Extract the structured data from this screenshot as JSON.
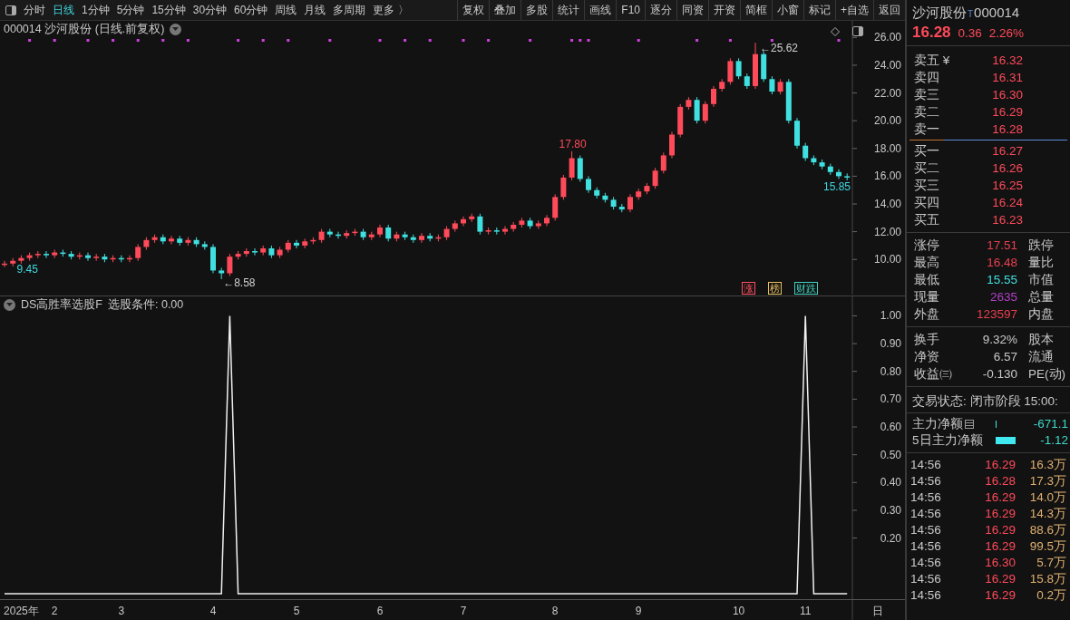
{
  "toolbar": {
    "periods": [
      {
        "label": "分时",
        "selected": false
      },
      {
        "label": "日线",
        "selected": true
      },
      {
        "label": "1分钟",
        "selected": false
      },
      {
        "label": "5分钟",
        "selected": false
      },
      {
        "label": "15分钟",
        "selected": false
      },
      {
        "label": "30分钟",
        "selected": false
      },
      {
        "label": "60分钟",
        "selected": false
      },
      {
        "label": "周线",
        "selected": false
      },
      {
        "label": "月线",
        "selected": false
      },
      {
        "label": "多周期",
        "selected": false
      },
      {
        "label": "更多 〉",
        "selected": false
      }
    ],
    "tools": [
      "复权",
      "叠加",
      "多股",
      "统计",
      "画线",
      "F10",
      "逐分",
      "同资",
      "开资",
      "简框",
      "小窗",
      "标记",
      "+自选",
      "返回"
    ]
  },
  "top_chart": {
    "title": "000014 沙河股份 (日线.前复权)",
    "chart_data": {
      "type": "candlestick",
      "ylim": [
        7.4,
        27.2
      ],
      "yticks": [
        {
          "value": 26,
          "label": "26.00"
        },
        {
          "value": 24,
          "label": "24.00"
        },
        {
          "value": 22,
          "label": "22.00"
        },
        {
          "value": 20,
          "label": "20.00"
        },
        {
          "value": 18,
          "label": "18.00"
        },
        {
          "value": 16,
          "label": "16.00"
        },
        {
          "value": 14,
          "label": "14.00"
        },
        {
          "value": 12,
          "label": "12.00"
        },
        {
          "value": 10,
          "label": "10.00"
        }
      ],
      "categories": [
        null,
        null,
        null,
        null,
        null,
        null,
        null,
        null,
        null,
        null,
        null,
        null,
        null,
        null,
        null,
        null,
        null,
        null,
        null,
        null,
        null,
        null,
        null,
        null,
        null,
        null,
        null,
        null,
        null,
        null,
        null,
        null,
        null,
        null,
        null,
        null,
        null,
        null,
        null,
        null,
        null,
        null,
        null,
        null,
        null,
        null,
        null,
        null,
        null,
        null,
        null,
        null,
        null,
        null,
        null,
        null,
        null,
        null,
        null,
        null,
        null,
        null,
        null,
        null,
        null,
        null,
        null,
        null,
        null,
        null,
        null,
        null,
        null,
        null,
        null,
        null,
        null,
        null,
        null,
        null,
        null,
        null,
        null,
        null,
        null,
        null,
        null,
        null,
        null,
        null,
        null,
        null,
        null,
        null,
        null,
        null,
        null,
        null,
        null,
        null,
        null,
        null
      ],
      "ohlc": [
        [
          9.6,
          9.9,
          9.45,
          9.7
        ],
        [
          9.7,
          10.1,
          9.5,
          9.9
        ],
        [
          9.9,
          10.3,
          9.7,
          10.1
        ],
        [
          10.1,
          10.5,
          9.9,
          10.3
        ],
        [
          10.3,
          10.6,
          10.1,
          10.4
        ],
        [
          10.4,
          10.6,
          10.1,
          10.3
        ],
        [
          10.3,
          10.7,
          10.1,
          10.5
        ],
        [
          10.5,
          10.7,
          10.2,
          10.4
        ],
        [
          10.4,
          10.6,
          10.0,
          10.2
        ],
        [
          10.2,
          10.5,
          10.0,
          10.3
        ],
        [
          10.3,
          10.5,
          9.9,
          10.1
        ],
        [
          10.1,
          10.4,
          9.9,
          10.2
        ],
        [
          10.2,
          10.4,
          9.8,
          10.0
        ],
        [
          10.0,
          10.3,
          9.8,
          10.1
        ],
        [
          10.1,
          10.3,
          9.8,
          10.0
        ],
        [
          10.0,
          10.3,
          9.8,
          10.1
        ],
        [
          10.1,
          11.1,
          9.9,
          10.9
        ],
        [
          10.9,
          11.6,
          10.7,
          11.4
        ],
        [
          11.4,
          11.8,
          11.2,
          11.6
        ],
        [
          11.6,
          11.8,
          11.1,
          11.3
        ],
        [
          11.3,
          11.7,
          11.1,
          11.5
        ],
        [
          11.5,
          11.7,
          11.0,
          11.2
        ],
        [
          11.2,
          11.6,
          11.0,
          11.4
        ],
        [
          11.4,
          11.6,
          10.9,
          11.1
        ],
        [
          11.1,
          11.3,
          10.7,
          10.9
        ],
        [
          10.9,
          11.1,
          9.0,
          9.2
        ],
        [
          9.2,
          9.4,
          8.58,
          9.0
        ],
        [
          9.0,
          10.4,
          8.8,
          10.2
        ],
        [
          10.2,
          10.6,
          10.0,
          10.4
        ],
        [
          10.4,
          10.8,
          10.2,
          10.6
        ],
        [
          10.6,
          10.8,
          10.3,
          10.5
        ],
        [
          10.5,
          11.0,
          10.3,
          10.8
        ],
        [
          10.8,
          11.0,
          10.1,
          10.3
        ],
        [
          10.3,
          10.9,
          10.1,
          10.7
        ],
        [
          10.7,
          11.4,
          10.5,
          11.2
        ],
        [
          11.2,
          11.4,
          10.8,
          11.0
        ],
        [
          11.0,
          11.5,
          10.8,
          11.3
        ],
        [
          11.3,
          11.6,
          11.1,
          11.4
        ],
        [
          11.4,
          12.2,
          11.2,
          12.0
        ],
        [
          12.0,
          12.2,
          11.6,
          11.8
        ],
        [
          11.8,
          12.0,
          11.5,
          11.7
        ],
        [
          11.7,
          12.1,
          11.5,
          11.9
        ],
        [
          11.9,
          12.2,
          11.7,
          12.0
        ],
        [
          12.0,
          12.2,
          11.4,
          11.6
        ],
        [
          11.6,
          12.0,
          11.4,
          11.8
        ],
        [
          11.8,
          12.5,
          11.6,
          12.3
        ],
        [
          12.3,
          12.5,
          11.3,
          11.5
        ],
        [
          11.5,
          12.0,
          11.3,
          11.8
        ],
        [
          11.8,
          12.0,
          11.4,
          11.6
        ],
        [
          11.6,
          11.8,
          11.2,
          11.4
        ],
        [
          11.4,
          11.9,
          11.2,
          11.7
        ],
        [
          11.7,
          11.9,
          11.3,
          11.5
        ],
        [
          11.5,
          11.8,
          11.3,
          11.6
        ],
        [
          11.6,
          12.4,
          11.4,
          12.2
        ],
        [
          12.2,
          12.8,
          12.0,
          12.6
        ],
        [
          12.6,
          13.1,
          12.4,
          12.9
        ],
        [
          12.9,
          13.3,
          12.7,
          13.1
        ],
        [
          13.1,
          13.3,
          11.8,
          12.0
        ],
        [
          12.0,
          12.3,
          11.8,
          12.1
        ],
        [
          12.1,
          12.3,
          11.8,
          12.0
        ],
        [
          12.0,
          12.4,
          11.8,
          12.2
        ],
        [
          12.2,
          12.7,
          12.0,
          12.5
        ],
        [
          12.5,
          13.0,
          12.3,
          12.8
        ],
        [
          12.8,
          13.0,
          12.2,
          12.4
        ],
        [
          12.4,
          12.8,
          12.2,
          12.6
        ],
        [
          12.6,
          13.2,
          12.4,
          13.0
        ],
        [
          13.0,
          14.7,
          12.8,
          14.5
        ],
        [
          14.5,
          16.1,
          14.3,
          15.9
        ],
        [
          15.9,
          17.8,
          15.7,
          17.3
        ],
        [
          17.3,
          17.5,
          15.6,
          15.8
        ],
        [
          15.8,
          16.0,
          14.8,
          15.0
        ],
        [
          15.0,
          15.2,
          14.4,
          14.6
        ],
        [
          14.6,
          14.8,
          14.1,
          14.3
        ],
        [
          14.3,
          14.5,
          13.6,
          13.8
        ],
        [
          13.8,
          14.0,
          13.4,
          13.6
        ],
        [
          13.6,
          14.7,
          13.4,
          14.5
        ],
        [
          14.5,
          15.1,
          14.3,
          14.9
        ],
        [
          14.9,
          15.5,
          14.7,
          15.3
        ],
        [
          15.3,
          16.6,
          15.1,
          16.4
        ],
        [
          16.4,
          17.7,
          16.2,
          17.5
        ],
        [
          17.5,
          19.2,
          17.3,
          19.0
        ],
        [
          19.0,
          21.2,
          18.8,
          21.0
        ],
        [
          21.0,
          21.7,
          20.8,
          21.5
        ],
        [
          21.5,
          21.7,
          19.8,
          20.0
        ],
        [
          20.0,
          21.4,
          19.8,
          21.2
        ],
        [
          21.2,
          22.5,
          21.0,
          22.3
        ],
        [
          22.3,
          23.0,
          22.1,
          22.8
        ],
        [
          22.8,
          24.5,
          22.6,
          24.3
        ],
        [
          24.3,
          24.5,
          23.0,
          23.2
        ],
        [
          23.2,
          23.4,
          22.3,
          22.5
        ],
        [
          22.5,
          25.62,
          22.3,
          24.8
        ],
        [
          24.8,
          25.0,
          22.8,
          23.0
        ],
        [
          23.0,
          23.2,
          21.9,
          22.1
        ],
        [
          22.1,
          23.0,
          21.9,
          22.8
        ],
        [
          22.8,
          23.0,
          19.8,
          20.0
        ],
        [
          20.0,
          20.2,
          18.0,
          18.2
        ],
        [
          18.2,
          18.4,
          17.1,
          17.3
        ],
        [
          17.3,
          17.5,
          16.8,
          17.0
        ],
        [
          17.0,
          17.2,
          16.5,
          16.7
        ],
        [
          16.7,
          16.9,
          16.1,
          16.3
        ],
        [
          16.3,
          16.5,
          15.8,
          16.0
        ],
        [
          16.0,
          16.2,
          15.7,
          15.9
        ]
      ]
    },
    "price_labels": [
      {
        "text": "9.45",
        "color": "#40d8e0"
      },
      {
        "text": "←8.58",
        "color": "#d0d0d0"
      },
      {
        "text": "17.80",
        "color": "#ff4a5a"
      },
      {
        "text": "←25.62",
        "color": "#d0d0d0"
      },
      {
        "text": "15.85",
        "color": "#40d8e0"
      }
    ],
    "badges": [
      {
        "text": "涨",
        "color": "#ff5060"
      },
      {
        "text": "榜",
        "color": "#e8c060"
      },
      {
        "text": "财跌",
        "color": "#40d0c0"
      }
    ]
  },
  "indicator": {
    "title": "DS高胜率选股F",
    "condition": "选股条件: 0.00",
    "chart_data": {
      "type": "line",
      "ylim": [
        -0.02,
        1.07
      ],
      "categories": [
        null,
        null,
        "2025年",
        null,
        null,
        null,
        "2",
        null,
        null,
        null,
        null,
        null,
        null,
        null,
        "3",
        null,
        null,
        null,
        null,
        null,
        null,
        null,
        null,
        null,
        null,
        "4",
        null,
        null,
        null,
        null,
        null,
        null,
        null,
        null,
        null,
        "5",
        null,
        null,
        null,
        null,
        null,
        null,
        null,
        null,
        null,
        "6",
        null,
        null,
        null,
        null,
        null,
        null,
        null,
        null,
        null,
        "7",
        null,
        null,
        null,
        null,
        null,
        null,
        null,
        null,
        null,
        null,
        "8",
        null,
        null,
        null,
        null,
        null,
        null,
        null,
        null,
        null,
        "9",
        null,
        null,
        null,
        null,
        null,
        null,
        null,
        null,
        null,
        null,
        null,
        "10",
        null,
        null,
        null,
        null,
        null,
        null,
        null,
        "11",
        null,
        null,
        null,
        null,
        null
      ],
      "values": [
        0,
        0,
        0,
        0,
        0,
        0,
        0,
        0,
        0,
        0,
        0,
        0,
        0,
        0,
        0,
        0,
        0,
        0,
        0,
        0,
        0,
        0,
        0,
        0,
        0,
        0,
        0,
        1,
        0,
        0,
        0,
        0,
        0,
        0,
        0,
        0,
        0,
        0,
        0,
        0,
        0,
        0,
        0,
        0,
        0,
        0,
        0,
        0,
        0,
        0,
        0,
        0,
        0,
        0,
        0,
        0,
        0,
        0,
        0,
        0,
        0,
        0,
        0,
        0,
        0,
        0,
        0,
        0,
        0,
        0,
        0,
        0,
        0,
        0,
        0,
        0,
        0,
        0,
        0,
        0,
        0,
        0,
        0,
        0,
        0,
        0,
        0,
        0,
        0,
        0,
        0,
        0,
        0,
        0,
        0,
        0,
        1,
        0,
        0,
        0,
        0,
        0
      ],
      "yticks": [
        {
          "value": 1,
          "label": "1.00"
        },
        {
          "value": 0.9,
          "label": "0.90"
        },
        {
          "value": 0.8,
          "label": "0.80"
        },
        {
          "value": 0.7,
          "label": "0.70"
        },
        {
          "value": 0.6,
          "label": "0.60"
        },
        {
          "value": 0.5,
          "label": "0.50"
        },
        {
          "value": 0.4,
          "label": "0.40"
        },
        {
          "value": 0.3,
          "label": "0.30"
        },
        {
          "value": 0.2,
          "label": "0.20"
        }
      ]
    },
    "corner_label": "日"
  },
  "quote": {
    "name": "沙河股份",
    "mark": "T",
    "code": "000014",
    "price": "16.28",
    "change": "0.36",
    "percent": "2.26%",
    "asks": [
      {
        "label": "卖五 ¥",
        "price": "16.32"
      },
      {
        "label": "卖四",
        "price": "16.31"
      },
      {
        "label": "卖三",
        "price": "16.30"
      },
      {
        "label": "卖二",
        "price": "16.29"
      },
      {
        "label": "卖一",
        "price": "16.28"
      }
    ],
    "bids": [
      {
        "label": "买一",
        "price": "16.27"
      },
      {
        "label": "买二",
        "price": "16.26"
      },
      {
        "label": "买三",
        "price": "16.25"
      },
      {
        "label": "买四",
        "price": "16.24"
      },
      {
        "label": "买五",
        "price": "16.23"
      }
    ],
    "stats": [
      {
        "label": "涨停",
        "value": "17.51",
        "color": "#e8404f",
        "label2": "跌停"
      },
      {
        "label": "最高",
        "value": "16.48",
        "color": "#e8404f",
        "label2": "量比"
      },
      {
        "label": "最低",
        "value": "15.55",
        "color": "#40e0e0",
        "label2": "市值"
      },
      {
        "label": "现量",
        "value": "2635",
        "color": "#b040c8",
        "label2": "总量"
      },
      {
        "label": "外盘",
        "value": "123597",
        "color": "#e8404f",
        "label2": "内盘"
      }
    ],
    "fundamentals": [
      {
        "label": "换手",
        "value": "9.32%",
        "label2": "股本"
      },
      {
        "label": "净资",
        "value": "6.57",
        "label2": "流通"
      },
      {
        "label": "收益㈢",
        "value": "-0.130",
        "label2": "PE(动)"
      }
    ],
    "status": "交易状态: 闭市阶段 15:00:",
    "flows": [
      {
        "label": "主力净额",
        "value": "-671.1"
      },
      {
        "label": "5日主力净额",
        "value": "-1.12"
      }
    ],
    "trades": [
      {
        "time": "14:56",
        "price": "16.29",
        "volume": "16.3万"
      },
      {
        "time": "14:56",
        "price": "16.28",
        "volume": "17.3万"
      },
      {
        "time": "14:56",
        "price": "16.29",
        "volume": "14.0万"
      },
      {
        "time": "14:56",
        "price": "16.29",
        "volume": "14.3万"
      },
      {
        "time": "14:56",
        "price": "16.29",
        "volume": "88.6万"
      },
      {
        "time": "14:56",
        "price": "16.29",
        "volume": "99.5万"
      },
      {
        "time": "14:56",
        "price": "16.30",
        "volume": "5.7万"
      },
      {
        "time": "14:56",
        "price": "16.29",
        "volume": "15.8万"
      },
      {
        "time": "14:56",
        "price": "16.29",
        "volume": "0.2万"
      }
    ]
  }
}
